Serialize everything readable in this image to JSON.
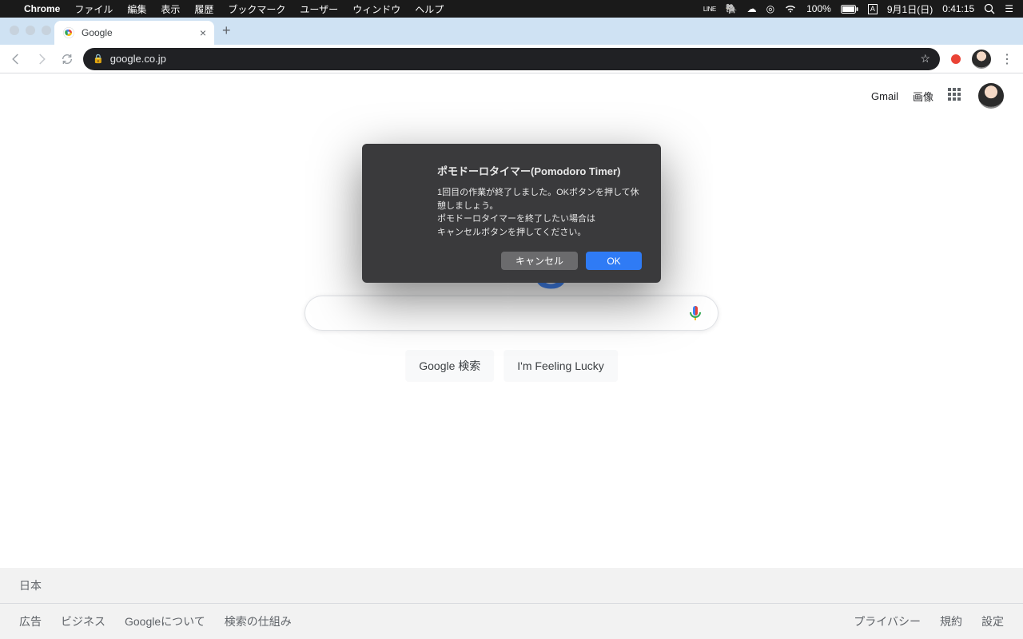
{
  "menubar": {
    "app_name": "Chrome",
    "items": [
      "ファイル",
      "編集",
      "表示",
      "履歴",
      "ブックマーク",
      "ユーザー",
      "ウィンドウ",
      "ヘルプ"
    ],
    "status": {
      "line_label": "LINE",
      "battery_pct": "100%",
      "input_indicator": "A",
      "date": "9月1日(日)",
      "time": "0:41:15"
    }
  },
  "tabstrip": {
    "tab_title": "Google"
  },
  "toolbar": {
    "url": "google.co.jp"
  },
  "google": {
    "header": {
      "gmail": "Gmail",
      "images": "画像"
    },
    "search_placeholder": "",
    "buttons": {
      "search": "Google 検索",
      "lucky": "I'm Feeling Lucky"
    },
    "footer": {
      "country": "日本",
      "left_links": [
        "広告",
        "ビジネス",
        "Googleについて",
        "検索の仕組み"
      ],
      "right_links": [
        "プライバシー",
        "規約",
        "設定"
      ]
    }
  },
  "dialog": {
    "title": "ポモドーロタイマー(Pomodoro Timer)",
    "line1": "1回目の作業が終了しました。OKボタンを押して休憩しましょう。",
    "line2": "ポモドーロタイマーを終了したい場合は",
    "line3": "キャンセルボタンを押してください。",
    "cancel": "キャンセル",
    "ok": "OK"
  }
}
